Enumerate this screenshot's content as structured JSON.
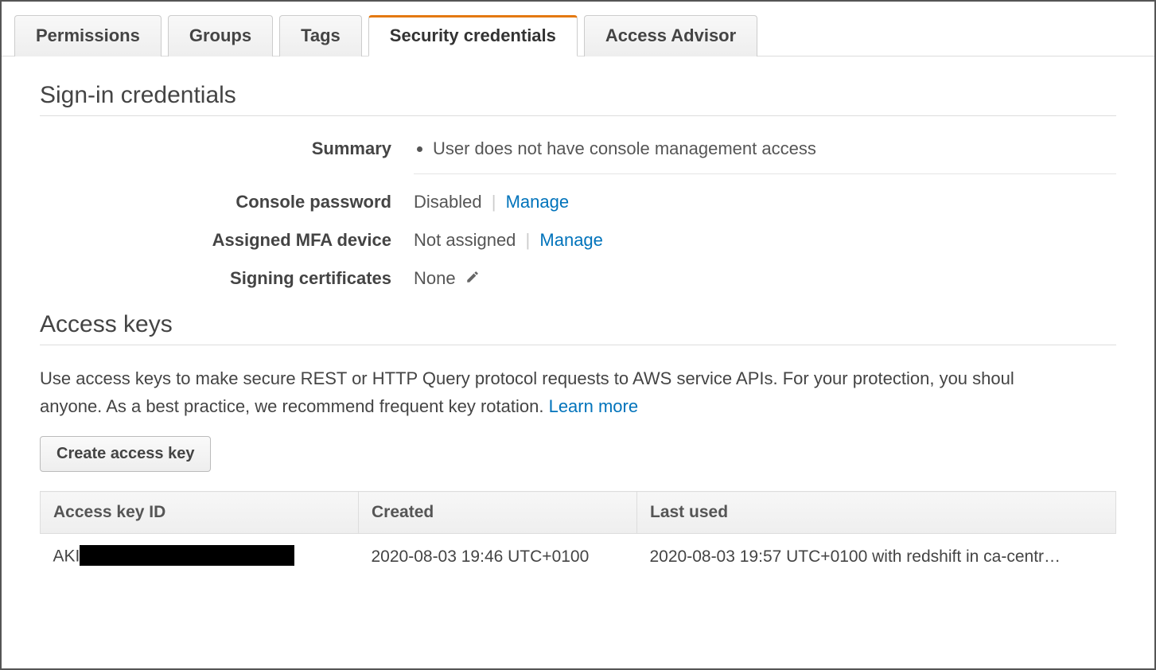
{
  "tabs": [
    {
      "label": "Permissions",
      "active": false
    },
    {
      "label": "Groups",
      "active": false
    },
    {
      "label": "Tags",
      "active": false
    },
    {
      "label": "Security credentials",
      "active": true
    },
    {
      "label": "Access Advisor",
      "active": false
    }
  ],
  "signin": {
    "heading": "Sign-in credentials",
    "summary_label": "Summary",
    "summary_item": "User does not have console management access",
    "console_password_label": "Console password",
    "console_password_value": "Disabled",
    "console_password_manage": "Manage",
    "mfa_label": "Assigned MFA device",
    "mfa_value": "Not assigned",
    "mfa_manage": "Manage",
    "signing_cert_label": "Signing certificates",
    "signing_cert_value": "None"
  },
  "access_keys": {
    "heading": "Access keys",
    "description_prefix": "Use access keys to make secure REST or HTTP Query protocol requests to AWS service APIs. For your protection, you shoul",
    "description_line2": "anyone. As a best practice, we recommend frequent key rotation. ",
    "learn_more": "Learn more",
    "create_button": "Create access key",
    "columns": {
      "id": "Access key ID",
      "created": "Created",
      "last_used": "Last used"
    },
    "rows": [
      {
        "id_prefix": "AKI",
        "created": "2020-08-03 19:46 UTC+0100",
        "last_used": "2020-08-03 19:57 UTC+0100 with redshift in ca-centr…"
      }
    ]
  }
}
